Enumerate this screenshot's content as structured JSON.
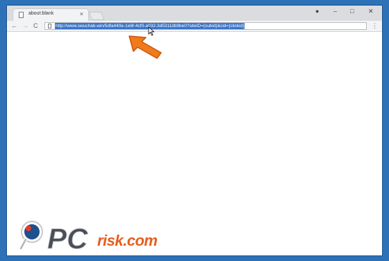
{
  "tab": {
    "title": "about:blank",
    "close_glyph": "×"
  },
  "window_controls": {
    "profile": "●",
    "minimize": "–",
    "maximize": "□",
    "close": "✕"
  },
  "nav": {
    "back": "←",
    "forward": "→",
    "reload": "C"
  },
  "address_bar": {
    "url": "http://www.swuchab.win/5dfa440e-1e6f-4cf0-a032-3d5311db9be0?siteID={subid}&cid={clickid}"
  },
  "menu": {
    "glyph": "⋮"
  },
  "watermark": {
    "letters": "PC",
    "suffix": "risk.com"
  },
  "colors": {
    "accent": "#f07a1c",
    "selection": "#3a74c9",
    "background": "#2d72b8"
  }
}
